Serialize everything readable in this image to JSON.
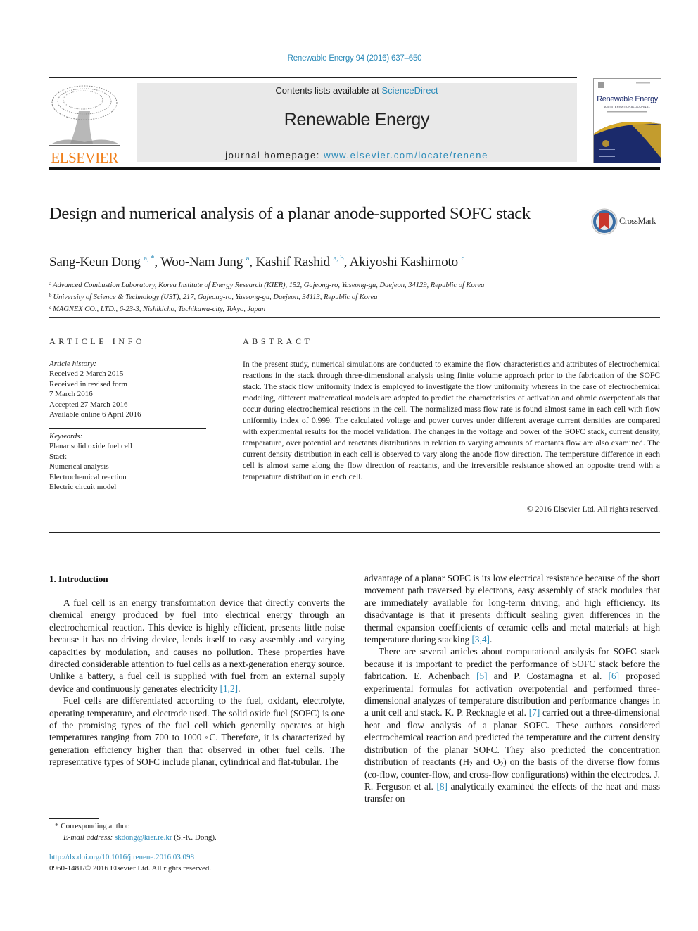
{
  "header": {
    "journal_ref": "Renewable Energy 94 (2016) 637–650",
    "contents_prefix": "Contents lists available at ",
    "contents_link": "ScienceDirect",
    "journal_name": "Renewable Energy",
    "homepage_prefix": "journal homepage: ",
    "homepage_link": "www.elsevier.com/locate/renene",
    "publisher_logo_text": "ELSEVIER",
    "cover": {
      "title": "Renewable Energy",
      "subtitle": "AN INTERNATIONAL JOURNAL"
    },
    "crossmark_label": "CrossMark",
    "colors": {
      "link": "#2a8ab8",
      "elsevier_orange": "#f07f1a",
      "cover_navy": "#1b2a6b",
      "cover_gold": "#d6a928",
      "banner_bg": "#e9e9e9"
    }
  },
  "article": {
    "title": "Design and numerical analysis of a planar anode-supported SOFC stack",
    "authors": [
      {
        "name": "Sang-Keun Dong",
        "sup": "a, *",
        "sep": ", "
      },
      {
        "name": "Woo-Nam Jung",
        "sup": "a",
        "sep": ", "
      },
      {
        "name": "Kashif Rashid",
        "sup": "a, b",
        "sep": ", "
      },
      {
        "name": "Akiyoshi Kashimoto",
        "sup": "c",
        "sep": ""
      }
    ],
    "affiliations": [
      {
        "mark": "a",
        "text": "Advanced Combustion Laboratory, Korea Institute of Energy Research (KIER), 152, Gajeong-ro, Yuseong-gu, Daejeon, 34129, Republic of Korea"
      },
      {
        "mark": "b",
        "text": "University of Science & Technology (UST), 217, Gajeong-ro, Yuseong-gu, Daejeon, 34113, Republic of Korea"
      },
      {
        "mark": "c",
        "text": "MAGNEX CO., LTD., 6-23-3, Nishikicho, Tachikawa-city, Tokyo, Japan"
      }
    ]
  },
  "article_info": {
    "heading": "ARTICLE INFO",
    "history_label": "Article history:",
    "history": [
      "Received 2 March 2015",
      "Received in revised form",
      "7 March 2016",
      "Accepted 27 March 2016",
      "Available online 6 April 2016"
    ],
    "keywords_label": "Keywords:",
    "keywords": [
      "Planar solid oxide fuel cell",
      "Stack",
      "Numerical analysis",
      "Electrochemical reaction",
      "Electric circuit model"
    ]
  },
  "abstract": {
    "heading": "ABSTRACT",
    "text": "In the present study, numerical simulations are conducted to examine the flow characteristics and attributes of electrochemical reactions in the stack through three-dimensional analysis using finite volume approach prior to the fabrication of the SOFC stack. The stack flow uniformity index is employed to investigate the flow uniformity whereas in the case of electrochemical modeling, different mathematical models are adopted to predict the characteristics of activation and ohmic overpotentials that occur during electrochemical reactions in the cell. The normalized mass flow rate is found almost same in each cell with flow uniformity index of 0.999. The calculated voltage and power curves under different average current densities are compared with experimental results for the model validation. The changes in the voltage and power of the SOFC stack, current density, temperature, over potential and reactants distributions in relation to varying amounts of reactants flow are also examined. The current density distribution in each cell is observed to vary along the anode flow direction. The temperature difference in each cell is almost same along the flow direction of reactants, and the irreversible resistance showed an opposite trend with a temperature distribution in each cell.",
    "copyright": "© 2016 Elsevier Ltd. All rights reserved."
  },
  "introduction": {
    "heading": "1.  Introduction",
    "p1_text": "A fuel cell is an energy transformation device that directly converts the chemical energy produced by fuel into electrical energy through an electrochemical reaction. This device is highly efficient, presents little noise because it has no driving device, lends itself to easy assembly and varying capacities by modulation, and causes no pollution. These properties have directed considerable attention to fuel cells as a next-generation energy source. Unlike a battery, a fuel cell is supplied with fuel from an external supply device and continuously generates electricity ",
    "p1_ref": "[1,2]",
    "p2_text": "Fuel cells are differentiated according to the fuel, oxidant, electrolyte, operating temperature, and electrode used. The solid oxide fuel (SOFC) is one of the promising types of the fuel cell which generally operates at high temperatures ranging from 700 to 1000 ◦C. Therefore, it is characterized by generation efficiency higher than that observed in other fuel cells. The representative types of SOFC include planar, cylindrical and flat-tubular. The",
    "p3_text": "advantage of a planar SOFC is its low electrical resistance because of the short movement path traversed by electrons, easy assembly of stack modules that are immediately available for long-term driving, and high efficiency. Its disadvantage is that it presents difficult sealing given differences in the thermal expansion coefficients of ceramic cells and metal materials at high temperature during stacking ",
    "p3_ref": "[3,4]",
    "p4_a": "There are several articles about computational analysis for SOFC stack because it is important to predict the performance of SOFC stack before the fabrication. E. Achenbach ",
    "p4_ref5": "[5]",
    "p4_b": " and P. Costamagna et al. ",
    "p4_ref6": "[6]",
    "p4_c": " proposed experimental formulas for activation overpotential and performed three-dimensional analyzes of temperature distribution and performance changes in a unit cell and stack. K. P. Recknagle et al. ",
    "p4_ref7": "[7]",
    "p4_d": " carried out a three-dimensional heat and flow analysis of a planar SOFC. These authors considered electrochemical reaction and predicted the temperature and the current density distribution of the planar SOFC. They also predicted the concentration distribution of reactants (H",
    "p4_sub1": "2",
    "p4_e": " and O",
    "p4_sub2": "2",
    "p4_f": ") on the basis of the diverse flow forms (co-flow, counter-flow, and cross-flow configurations) within the electrodes. J. R. Ferguson et al. ",
    "p4_ref8": "[8]",
    "p4_g": " analytically examined the effects of the heat and mass transfer on"
  },
  "footnote": {
    "corresponding": "* Corresponding author.",
    "email_label": "E-mail address: ",
    "email": "skdong@kier.re.kr",
    "email_suffix": " (S.-K. Dong).",
    "doi": "http://dx.doi.org/10.1016/j.renene.2016.03.098",
    "issn_line": "0960-1481/© 2016 Elsevier Ltd. All rights reserved."
  }
}
